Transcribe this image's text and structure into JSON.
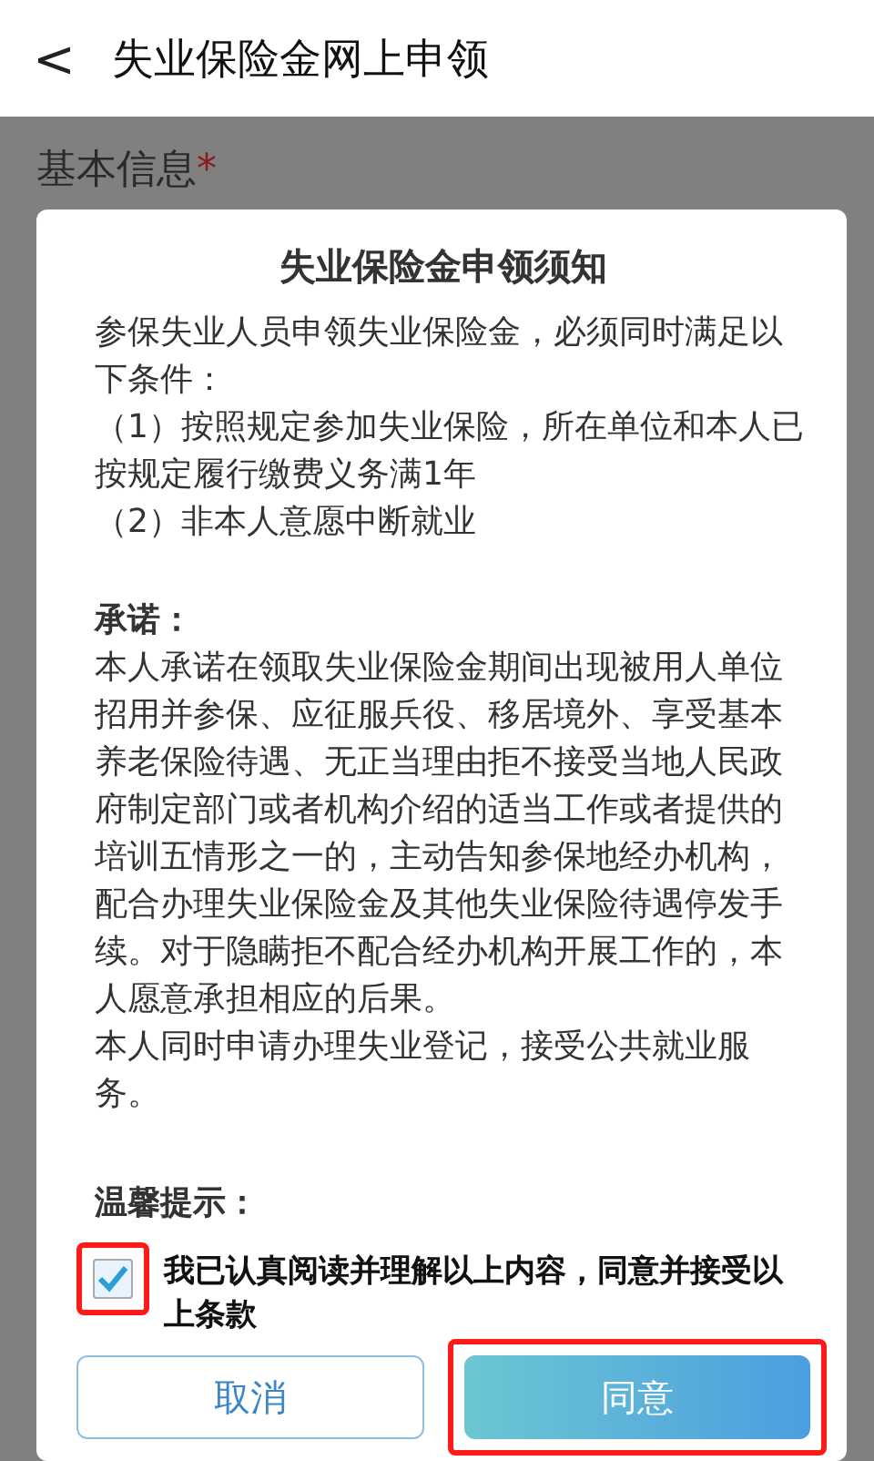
{
  "header": {
    "back": "<",
    "title": "失业保险金网上申领"
  },
  "background_form": {
    "section_label": "基本信息",
    "required_mark": "*"
  },
  "dialog": {
    "title": "失业保险金申领须知",
    "conditions": [
      "参保失业人员申领失业保险金，必须同时满足以下条件：",
      "（1）按照规定参加失业保险，所在单位和本人已按规定履行缴费义务满1年",
      "（2）非本人意愿中断就业"
    ],
    "promise_heading": "承诺：",
    "promise": [
      "本人承诺在领取失业保险金期间出现被用人单位招用并参保、应征服兵役、移居境外、享受基本养老保险待遇、无正当理由拒不接受当地人民政府制定部门或者机构介绍的适当工作或者提供的培训五情形之一的，主动告知参保地经办机构，配合办理失业保险金及其他失业保险待遇停发手续。对于隐瞒拒不配合经办机构开展工作的，本人愿意承担相应的后果。",
      "本人同时申请办理失业登记，接受公共就业服务。"
    ],
    "tip_heading": "温馨提示：",
    "agreement": {
      "label": "我已认真阅读并理解以上内容，同意并接受以上条款",
      "checked": true,
      "highlighted": true
    },
    "buttons": [
      {
        "label": "取消",
        "kind": "secondary",
        "highlighted": false
      },
      {
        "label": "同意",
        "kind": "primary",
        "highlighted": true
      }
    ]
  }
}
